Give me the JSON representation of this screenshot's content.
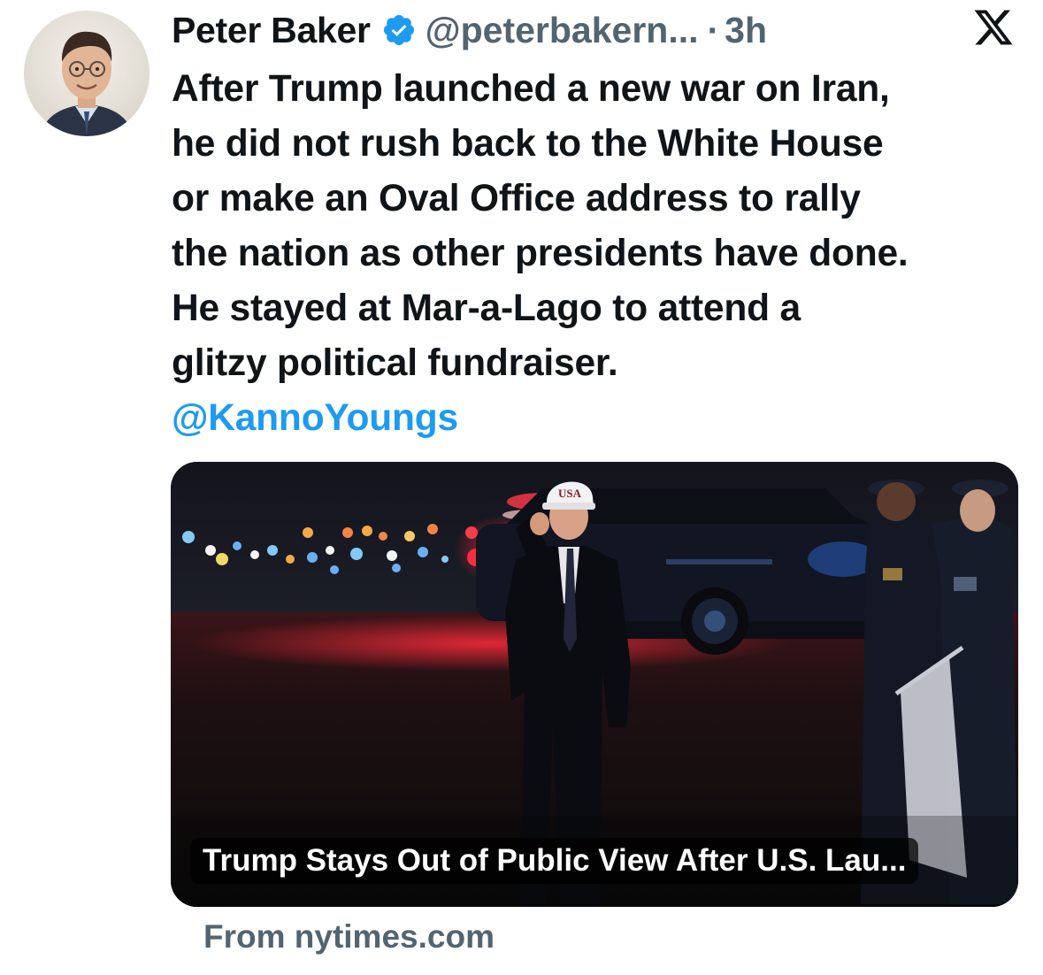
{
  "author": {
    "name": "Peter Baker",
    "handle": "@peterbakern...",
    "separator": "·",
    "time": "3h",
    "verified_icon": "verified-badge-icon",
    "avatar": "author-avatar-photo"
  },
  "platform_icon": "x-logo-icon",
  "tweet": {
    "lines": [
      "After Trump launched a new war on Iran,",
      "he did not rush back to the White House",
      "or make an Oval Office address to rally",
      "the nation as other presidents have done.",
      "He stayed at Mar-a-Lago to attend a",
      "glitzy political fundraiser."
    ],
    "mention": "@KannoYoungs"
  },
  "link_card": {
    "image": "night-tarmac-photo",
    "cap_text": "USA",
    "title": "Trump Stays Out of Public View After U.S. Lau...",
    "source": "From nytimes.com"
  },
  "colors": {
    "text_primary": "#0f1419",
    "text_secondary": "#536471",
    "accent": "#1d9bf0"
  }
}
